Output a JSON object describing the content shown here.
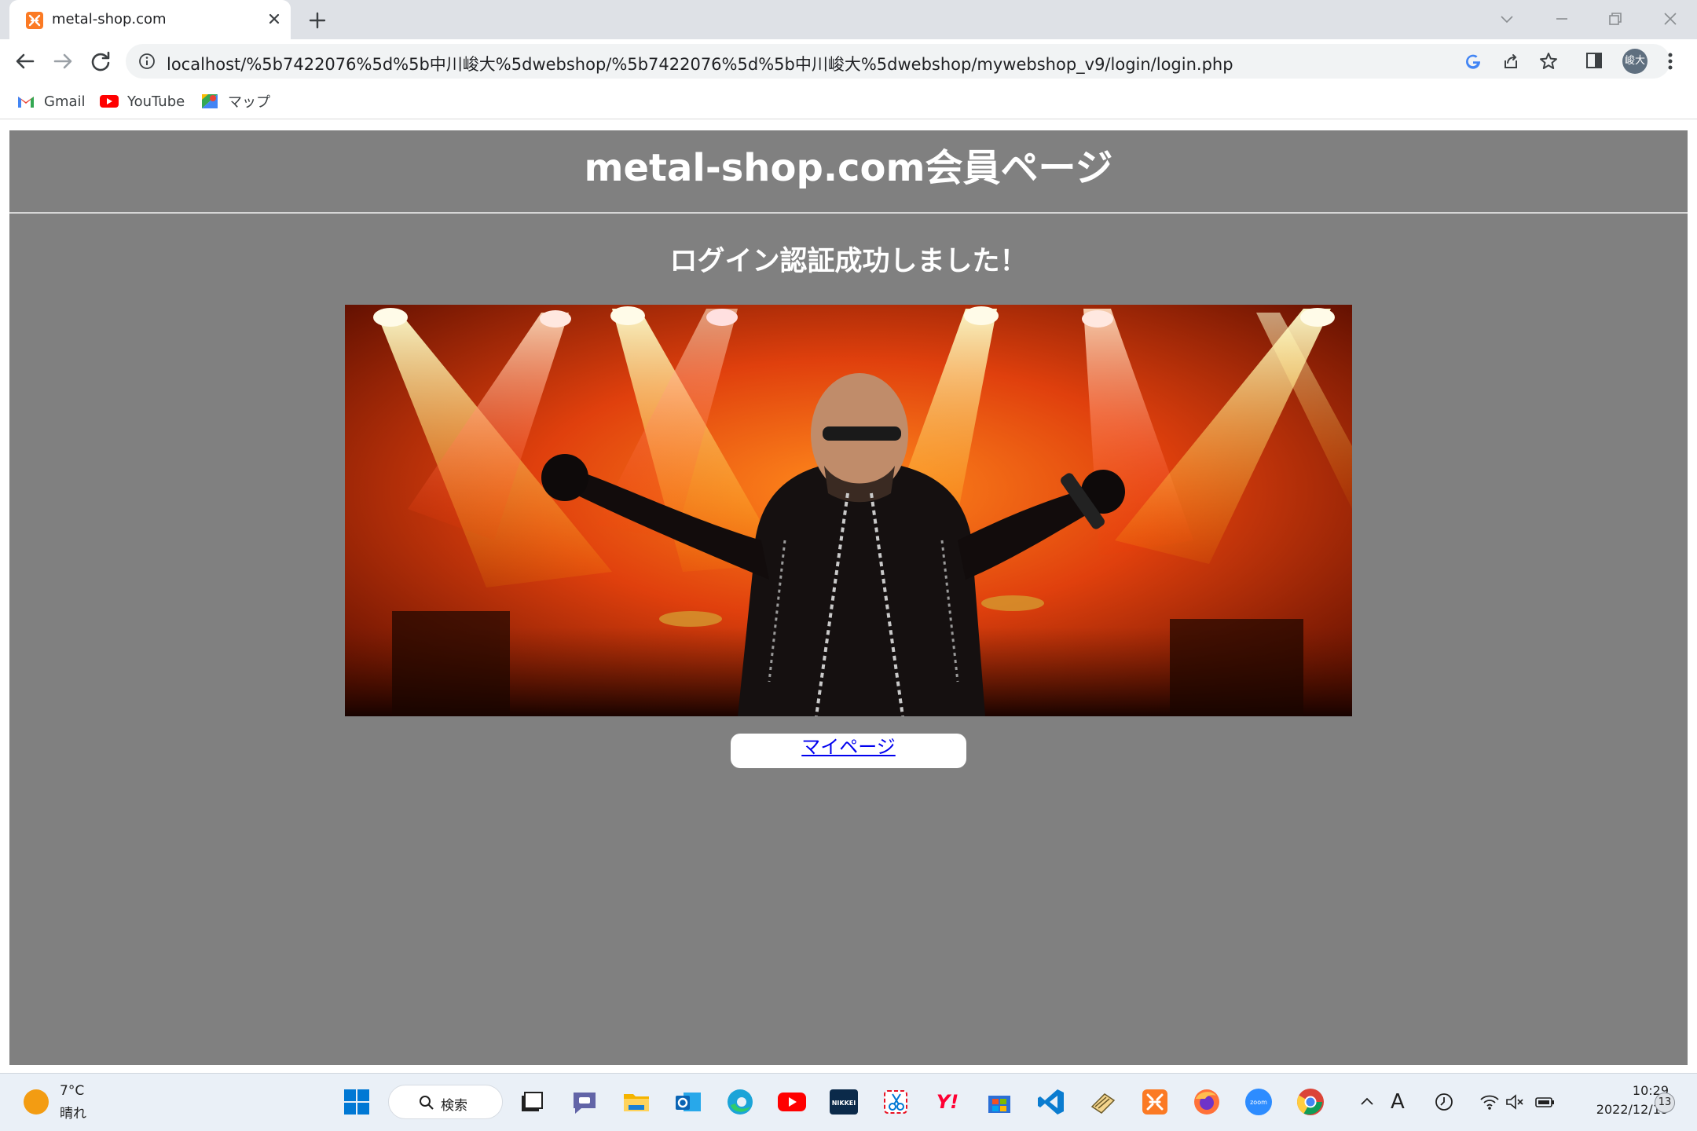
{
  "browser": {
    "tab": {
      "title": "metal-shop.com",
      "favicon": "xampp-icon"
    },
    "new_tab_icon": "plus-icon",
    "url": "localhost/%5b7422076%5d%5b中川峻大%5dwebshop/%5b7422076%5d%5b中川峻大%5dwebshop/mywebshop_v9/login/login.php",
    "profile_initials": "峻大",
    "bookmarks": [
      {
        "label": "Gmail",
        "icon": "gmail-icon"
      },
      {
        "label": "YouTube",
        "icon": "youtube-icon"
      },
      {
        "label": "マップ",
        "icon": "maps-icon"
      }
    ]
  },
  "page": {
    "title": "metal-shop.com会員ページ",
    "message": "ログイン認証成功しました！",
    "hero_image": "metal-singer-on-stage-photo",
    "mypage_link": "マイページ",
    "colors": {
      "background": "#808080",
      "text": "#ffffff",
      "link": "#0000ee"
    }
  },
  "taskbar": {
    "weather": {
      "temp": "7°C",
      "condition": "晴れ"
    },
    "search_label": "検索",
    "apps": [
      "windows-start",
      "search",
      "task-view",
      "teams",
      "file-explorer",
      "outlook",
      "edge",
      "youtube",
      "nikkei",
      "snipping-tool",
      "yahoo",
      "store",
      "vscode",
      "notepad",
      "xampp",
      "firefox",
      "zoom",
      "chrome"
    ],
    "nikkei_label": "NIKKEI",
    "zoom_label": "zoom",
    "tray": {
      "ime": "A"
    },
    "clock": {
      "time": "10:29",
      "date": "2022/12/19"
    },
    "notifications": "13"
  }
}
